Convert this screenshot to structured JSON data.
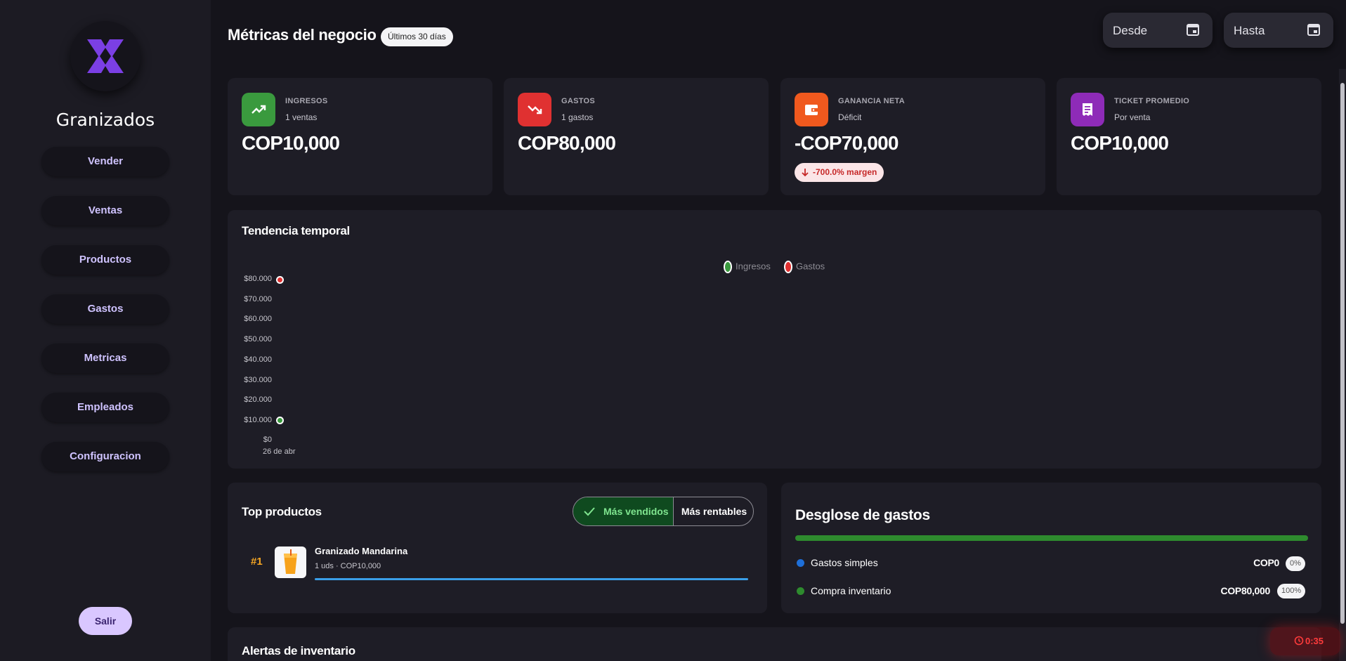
{
  "sidebar": {
    "brand": "Granizados",
    "items": [
      {
        "label": "Vender"
      },
      {
        "label": "Ventas"
      },
      {
        "label": "Productos"
      },
      {
        "label": "Gastos"
      },
      {
        "label": "Metricas"
      },
      {
        "label": "Empleados"
      },
      {
        "label": "Configuracion"
      }
    ],
    "logout": "Salir"
  },
  "header": {
    "title": "Métricas del negocio",
    "range_badge": "Últimos 30 días",
    "date_from": "Desde",
    "date_to": "Hasta"
  },
  "kpis": [
    {
      "label": "INGRESOS",
      "sub": "1 ventas",
      "value": "COP10,000",
      "color": "#3a9a3e",
      "icon": "trending-up-icon"
    },
    {
      "label": "GASTOS",
      "sub": "1 gastos",
      "value": "COP80,000",
      "color": "#e03131",
      "icon": "trending-down-icon"
    },
    {
      "label": "GANANCIA NETA",
      "sub": "Déficit",
      "value": "-COP70,000",
      "color": "#f0591e",
      "icon": "wallet-icon",
      "badge": "-700.0% margen"
    },
    {
      "label": "TICKET PROMEDIO",
      "sub": "Por venta",
      "value": "COP10,000",
      "color": "#8e2bb8",
      "icon": "receipt-icon"
    }
  ],
  "trend": {
    "title": "Tendencia temporal",
    "legend": [
      {
        "name": "Ingresos",
        "color": "#3a9a3e"
      },
      {
        "name": "Gastos",
        "color": "#e03131"
      }
    ]
  },
  "chart_data": {
    "type": "line",
    "title": "Tendencia temporal",
    "x": [
      "26 de abr"
    ],
    "series": [
      {
        "name": "Ingresos",
        "values": [
          10000
        ]
      },
      {
        "name": "Gastos",
        "values": [
          80000
        ]
      }
    ],
    "yticks": [
      "$0",
      "$10.000",
      "$20.000",
      "$30.000",
      "$40.000",
      "$50.000",
      "$60.000",
      "$70.000",
      "$80.000"
    ],
    "ylim": [
      0,
      80000
    ],
    "legend": "top-center",
    "grid": false
  },
  "top_products": {
    "title": "Top productos",
    "toggle_active": "Más vendidos",
    "toggle_other": "Más rentables",
    "items": [
      {
        "rank": "#1",
        "name": "Granizado Mandarina",
        "meta": "1 uds · COP10,000",
        "share": 1.0
      }
    ]
  },
  "expenses": {
    "title": "Desglose de gastos",
    "bar_share": 1.0,
    "rows": [
      {
        "label": "Gastos simples",
        "amount": "COP0",
        "pct": "0%",
        "color": "#1e6fd9"
      },
      {
        "label": "Compra inventario",
        "amount": "COP80,000",
        "pct": "100%",
        "color": "#2e8b2e"
      }
    ]
  },
  "alerts": {
    "title": "Alertas de inventario"
  },
  "timer": {
    "value": "0:35"
  }
}
